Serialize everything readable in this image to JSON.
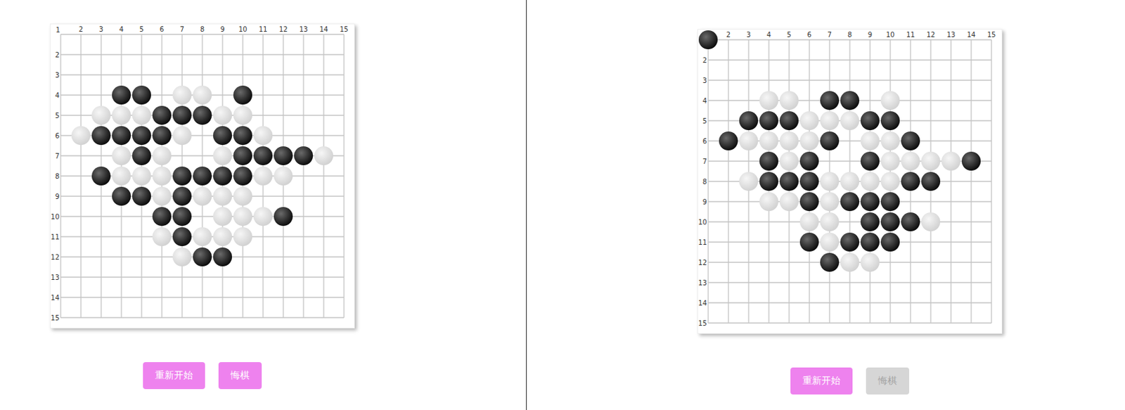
{
  "boards": [
    {
      "cornerLabel": "1",
      "colLabels": [
        "2",
        "3",
        "4",
        "5",
        "6",
        "7",
        "8",
        "9",
        "10",
        "11",
        "12",
        "13",
        "14",
        "15"
      ],
      "rowLabels": [
        "2",
        "3",
        "4",
        "5",
        "6",
        "7",
        "8",
        "9",
        "10",
        "11",
        "12",
        "13",
        "14",
        "15"
      ],
      "stones": [
        {
          "row": 4,
          "col": 4,
          "kind": "black"
        },
        {
          "row": 4,
          "col": 5,
          "kind": "black"
        },
        {
          "row": 4,
          "col": 7,
          "kind": "white"
        },
        {
          "row": 4,
          "col": 8,
          "kind": "white"
        },
        {
          "row": 4,
          "col": 10,
          "kind": "black"
        },
        {
          "row": 5,
          "col": 3,
          "kind": "white"
        },
        {
          "row": 5,
          "col": 4,
          "kind": "white"
        },
        {
          "row": 5,
          "col": 5,
          "kind": "white"
        },
        {
          "row": 5,
          "col": 6,
          "kind": "black"
        },
        {
          "row": 5,
          "col": 7,
          "kind": "black"
        },
        {
          "row": 5,
          "col": 8,
          "kind": "black"
        },
        {
          "row": 5,
          "col": 9,
          "kind": "white"
        },
        {
          "row": 5,
          "col": 10,
          "kind": "white"
        },
        {
          "row": 6,
          "col": 2,
          "kind": "white"
        },
        {
          "row": 6,
          "col": 3,
          "kind": "black"
        },
        {
          "row": 6,
          "col": 4,
          "kind": "black"
        },
        {
          "row": 6,
          "col": 5,
          "kind": "black"
        },
        {
          "row": 6,
          "col": 6,
          "kind": "black"
        },
        {
          "row": 6,
          "col": 7,
          "kind": "white"
        },
        {
          "row": 6,
          "col": 9,
          "kind": "black"
        },
        {
          "row": 6,
          "col": 10,
          "kind": "black"
        },
        {
          "row": 6,
          "col": 11,
          "kind": "white"
        },
        {
          "row": 7,
          "col": 4,
          "kind": "white"
        },
        {
          "row": 7,
          "col": 5,
          "kind": "black"
        },
        {
          "row": 7,
          "col": 6,
          "kind": "white"
        },
        {
          "row": 7,
          "col": 9,
          "kind": "white"
        },
        {
          "row": 7,
          "col": 10,
          "kind": "black"
        },
        {
          "row": 7,
          "col": 11,
          "kind": "black"
        },
        {
          "row": 7,
          "col": 12,
          "kind": "black"
        },
        {
          "row": 7,
          "col": 13,
          "kind": "black"
        },
        {
          "row": 7,
          "col": 14,
          "kind": "white"
        },
        {
          "row": 8,
          "col": 3,
          "kind": "black"
        },
        {
          "row": 8,
          "col": 4,
          "kind": "white"
        },
        {
          "row": 8,
          "col": 5,
          "kind": "white"
        },
        {
          "row": 8,
          "col": 6,
          "kind": "white"
        },
        {
          "row": 8,
          "col": 7,
          "kind": "black"
        },
        {
          "row": 8,
          "col": 8,
          "kind": "black"
        },
        {
          "row": 8,
          "col": 9,
          "kind": "black"
        },
        {
          "row": 8,
          "col": 10,
          "kind": "black"
        },
        {
          "row": 8,
          "col": 11,
          "kind": "white"
        },
        {
          "row": 8,
          "col": 12,
          "kind": "white"
        },
        {
          "row": 9,
          "col": 4,
          "kind": "black"
        },
        {
          "row": 9,
          "col": 5,
          "kind": "black"
        },
        {
          "row": 9,
          "col": 6,
          "kind": "white"
        },
        {
          "row": 9,
          "col": 7,
          "kind": "black"
        },
        {
          "row": 9,
          "col": 8,
          "kind": "white"
        },
        {
          "row": 9,
          "col": 9,
          "kind": "white"
        },
        {
          "row": 9,
          "col": 10,
          "kind": "white"
        },
        {
          "row": 10,
          "col": 6,
          "kind": "black"
        },
        {
          "row": 10,
          "col": 7,
          "kind": "black"
        },
        {
          "row": 10,
          "col": 9,
          "kind": "white"
        },
        {
          "row": 10,
          "col": 10,
          "kind": "white"
        },
        {
          "row": 10,
          "col": 11,
          "kind": "white"
        },
        {
          "row": 10,
          "col": 12,
          "kind": "black"
        },
        {
          "row": 11,
          "col": 6,
          "kind": "white"
        },
        {
          "row": 11,
          "col": 7,
          "kind": "black"
        },
        {
          "row": 11,
          "col": 8,
          "kind": "white"
        },
        {
          "row": 11,
          "col": 9,
          "kind": "white"
        },
        {
          "row": 11,
          "col": 10,
          "kind": "white"
        },
        {
          "row": 12,
          "col": 7,
          "kind": "white"
        },
        {
          "row": 12,
          "col": 8,
          "kind": "black"
        },
        {
          "row": 12,
          "col": 9,
          "kind": "black"
        }
      ],
      "buttons": [
        {
          "label": "重新开始",
          "disabled": false
        },
        {
          "label": "悔棋",
          "disabled": false
        }
      ]
    },
    {
      "colLabels": [
        "2",
        "3",
        "4",
        "5",
        "6",
        "7",
        "8",
        "9",
        "10",
        "11",
        "12",
        "13",
        "14",
        "15"
      ],
      "rowLabels": [
        "2",
        "3",
        "4",
        "5",
        "6",
        "7",
        "8",
        "9",
        "10",
        "11",
        "12",
        "13",
        "14",
        "15"
      ],
      "stones": [
        {
          "row": 1,
          "col": 1,
          "kind": "black"
        },
        {
          "row": 4,
          "col": 4,
          "kind": "white"
        },
        {
          "row": 4,
          "col": 5,
          "kind": "white"
        },
        {
          "row": 4,
          "col": 7,
          "kind": "black"
        },
        {
          "row": 4,
          "col": 8,
          "kind": "black"
        },
        {
          "row": 4,
          "col": 10,
          "kind": "white"
        },
        {
          "row": 5,
          "col": 3,
          "kind": "black"
        },
        {
          "row": 5,
          "col": 4,
          "kind": "black"
        },
        {
          "row": 5,
          "col": 5,
          "kind": "black"
        },
        {
          "row": 5,
          "col": 6,
          "kind": "white"
        },
        {
          "row": 5,
          "col": 7,
          "kind": "white"
        },
        {
          "row": 5,
          "col": 8,
          "kind": "white"
        },
        {
          "row": 5,
          "col": 9,
          "kind": "black"
        },
        {
          "row": 5,
          "col": 10,
          "kind": "black"
        },
        {
          "row": 6,
          "col": 2,
          "kind": "black"
        },
        {
          "row": 6,
          "col": 3,
          "kind": "white"
        },
        {
          "row": 6,
          "col": 4,
          "kind": "white"
        },
        {
          "row": 6,
          "col": 5,
          "kind": "white"
        },
        {
          "row": 6,
          "col": 6,
          "kind": "white"
        },
        {
          "row": 6,
          "col": 7,
          "kind": "black"
        },
        {
          "row": 6,
          "col": 9,
          "kind": "white"
        },
        {
          "row": 6,
          "col": 10,
          "kind": "white"
        },
        {
          "row": 6,
          "col": 11,
          "kind": "black"
        },
        {
          "row": 7,
          "col": 4,
          "kind": "black"
        },
        {
          "row": 7,
          "col": 5,
          "kind": "white"
        },
        {
          "row": 7,
          "col": 6,
          "kind": "black"
        },
        {
          "row": 7,
          "col": 9,
          "kind": "black"
        },
        {
          "row": 7,
          "col": 10,
          "kind": "white"
        },
        {
          "row": 7,
          "col": 11,
          "kind": "white"
        },
        {
          "row": 7,
          "col": 12,
          "kind": "white"
        },
        {
          "row": 7,
          "col": 13,
          "kind": "white"
        },
        {
          "row": 7,
          "col": 14,
          "kind": "black"
        },
        {
          "row": 8,
          "col": 3,
          "kind": "white"
        },
        {
          "row": 8,
          "col": 4,
          "kind": "black"
        },
        {
          "row": 8,
          "col": 5,
          "kind": "black"
        },
        {
          "row": 8,
          "col": 6,
          "kind": "black"
        },
        {
          "row": 8,
          "col": 7,
          "kind": "white"
        },
        {
          "row": 8,
          "col": 8,
          "kind": "white"
        },
        {
          "row": 8,
          "col": 9,
          "kind": "white"
        },
        {
          "row": 8,
          "col": 10,
          "kind": "white"
        },
        {
          "row": 8,
          "col": 11,
          "kind": "black"
        },
        {
          "row": 8,
          "col": 12,
          "kind": "black"
        },
        {
          "row": 9,
          "col": 4,
          "kind": "white"
        },
        {
          "row": 9,
          "col": 5,
          "kind": "white"
        },
        {
          "row": 9,
          "col": 6,
          "kind": "black"
        },
        {
          "row": 9,
          "col": 7,
          "kind": "white"
        },
        {
          "row": 9,
          "col": 8,
          "kind": "black"
        },
        {
          "row": 9,
          "col": 9,
          "kind": "black"
        },
        {
          "row": 9,
          "col": 10,
          "kind": "black"
        },
        {
          "row": 10,
          "col": 6,
          "kind": "white"
        },
        {
          "row": 10,
          "col": 7,
          "kind": "white"
        },
        {
          "row": 10,
          "col": 9,
          "kind": "black"
        },
        {
          "row": 10,
          "col": 10,
          "kind": "black"
        },
        {
          "row": 10,
          "col": 11,
          "kind": "black"
        },
        {
          "row": 10,
          "col": 12,
          "kind": "white"
        },
        {
          "row": 11,
          "col": 6,
          "kind": "black"
        },
        {
          "row": 11,
          "col": 7,
          "kind": "white"
        },
        {
          "row": 11,
          "col": 8,
          "kind": "black"
        },
        {
          "row": 11,
          "col": 9,
          "kind": "black"
        },
        {
          "row": 11,
          "col": 10,
          "kind": "black"
        },
        {
          "row": 12,
          "col": 7,
          "kind": "black"
        },
        {
          "row": 12,
          "col": 8,
          "kind": "white"
        },
        {
          "row": 12,
          "col": 9,
          "kind": "white"
        }
      ],
      "buttons": [
        {
          "label": "重新开始",
          "disabled": false
        },
        {
          "label": "悔棋",
          "disabled": true
        }
      ]
    }
  ]
}
